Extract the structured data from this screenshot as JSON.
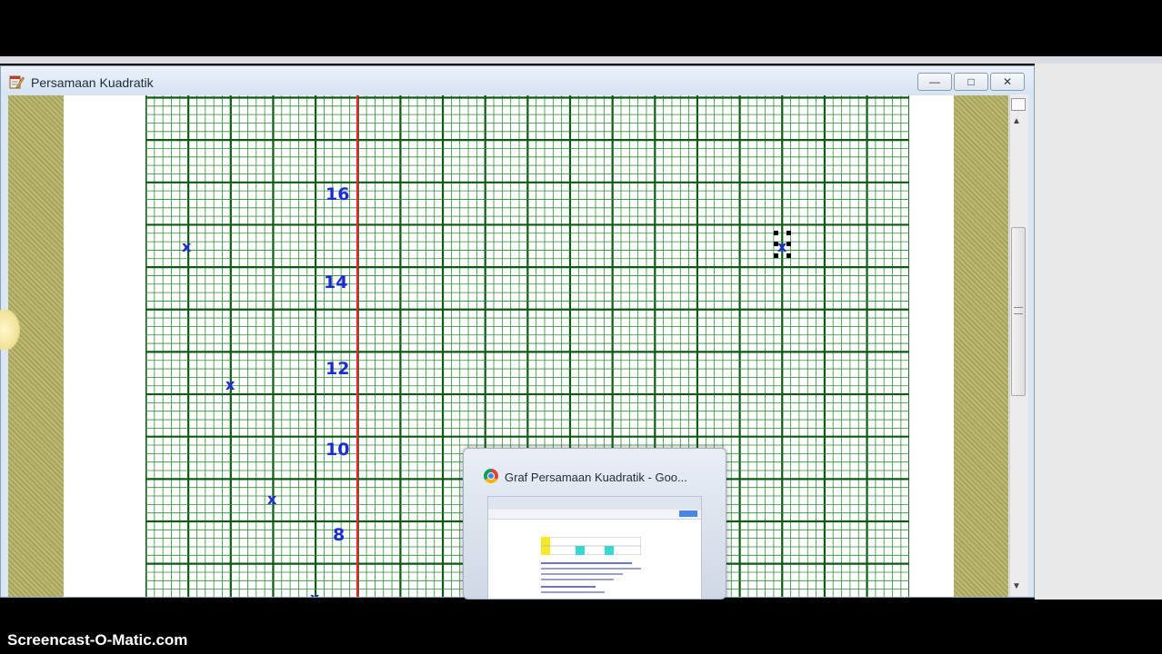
{
  "window": {
    "title": "Persamaan Kuadratik",
    "buttons": {
      "minimize": "—",
      "maximize": "□",
      "close": "✕"
    }
  },
  "graph": {
    "y_labels": [
      "16",
      "14",
      "12",
      "10",
      "8"
    ],
    "accent_line_color": "#e8262b",
    "grid_major_color": "#0c5a12",
    "grid_minor_color": "#2f8a36",
    "marker_symbol": "x",
    "marker_color": "#1a2bd1"
  },
  "taskbar_preview": {
    "title": "Graf Persamaan Kuadratik - Goo..."
  },
  "watermark": "Screencast-O-Matic.com",
  "icons": {
    "app": "notepad-pen-icon",
    "preview": "chrome-icon"
  }
}
